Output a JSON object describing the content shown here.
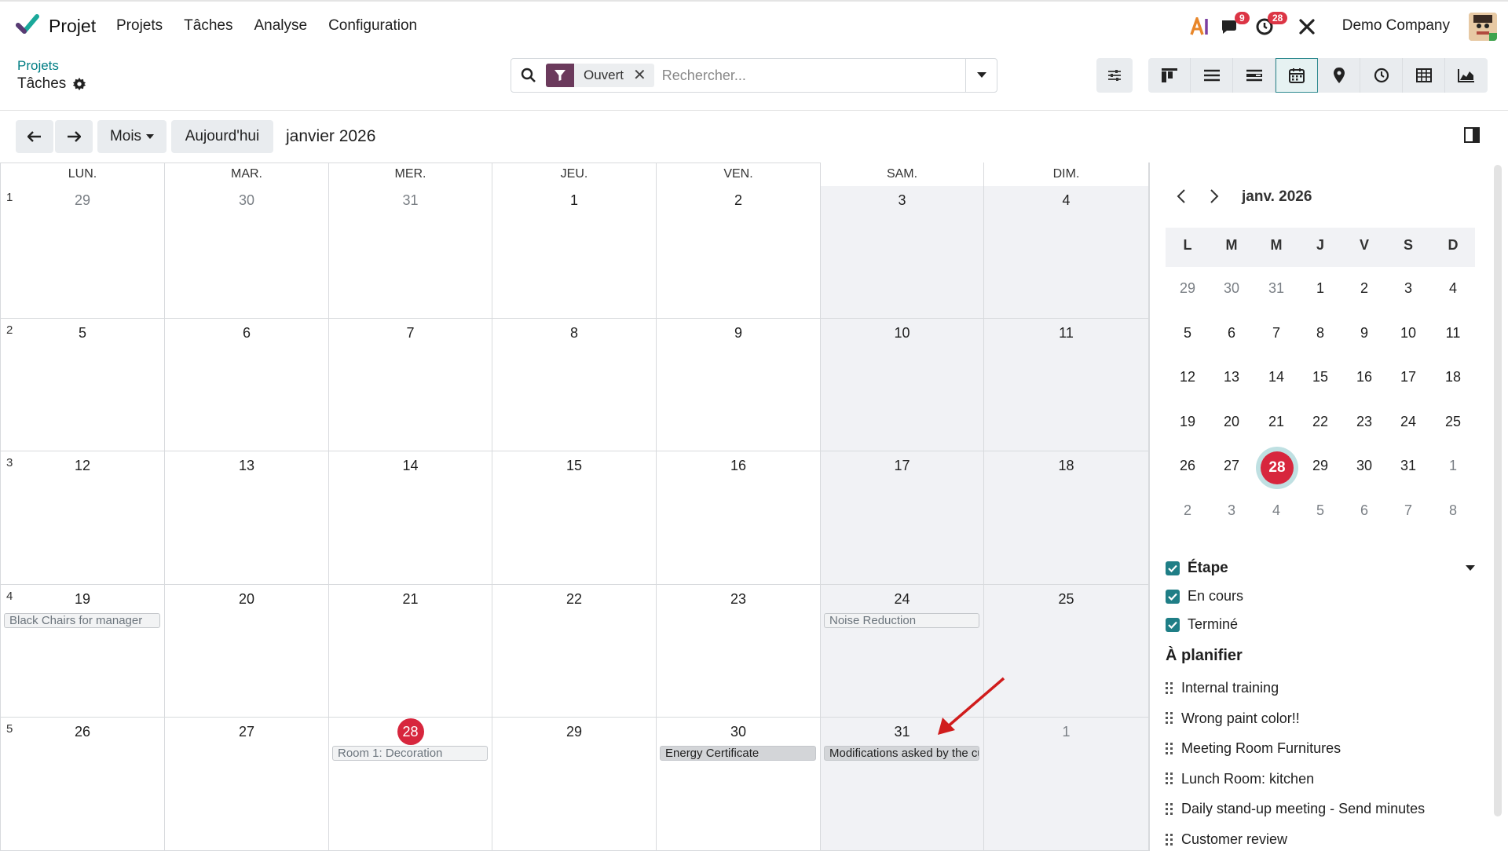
{
  "navbar": {
    "app_name": "Projet",
    "menu": [
      "Projets",
      "Tâches",
      "Analyse",
      "Configuration"
    ],
    "messages_badge": "9",
    "activities_badge": "28",
    "company": "Demo Company"
  },
  "breadcrumb": {
    "parent": "Projets",
    "current": "Tâches"
  },
  "search": {
    "facet": "Ouvert",
    "placeholder": "Rechercher..."
  },
  "toolbar": {
    "scale": "Mois",
    "today": "Aujourd'hui",
    "title": "janvier 2026"
  },
  "calendar": {
    "weekdays": [
      "LUN.",
      "MAR.",
      "MER.",
      "JEU.",
      "VEN.",
      "SAM.",
      "DIM."
    ],
    "weeks": [
      {
        "num": "1",
        "days": [
          "29",
          "30",
          "31",
          "1",
          "2",
          "3",
          "4"
        ]
      },
      {
        "num": "2",
        "days": [
          "5",
          "6",
          "7",
          "8",
          "9",
          "10",
          "11"
        ]
      },
      {
        "num": "3",
        "days": [
          "12",
          "13",
          "14",
          "15",
          "16",
          "17",
          "18"
        ]
      },
      {
        "num": "4",
        "days": [
          "19",
          "20",
          "21",
          "22",
          "23",
          "24",
          "25"
        ]
      },
      {
        "num": "5",
        "days": [
          "26",
          "27",
          "28",
          "29",
          "30",
          "31",
          "1"
        ]
      }
    ],
    "events": [
      {
        "label": "Black Chairs for manager",
        "week": 3,
        "day": 0,
        "style": "light"
      },
      {
        "label": "Noise Reduction",
        "week": 3,
        "day": 5,
        "style": "light"
      },
      {
        "label": "Room 1: Decoration",
        "week": 4,
        "day": 2,
        "style": "light"
      },
      {
        "label": "Energy Certificate",
        "week": 4,
        "day": 4,
        "style": "dark"
      },
      {
        "label": "Modifications asked by the customer",
        "week": 4,
        "day": 5,
        "style": "dark"
      }
    ]
  },
  "mini_calendar": {
    "title": "janv. 2026",
    "headers": [
      "L",
      "M",
      "M",
      "J",
      "V",
      "S",
      "D"
    ],
    "rows": [
      [
        "29",
        "30",
        "31",
        "1",
        "2",
        "3",
        "4"
      ],
      [
        "5",
        "6",
        "7",
        "8",
        "9",
        "10",
        "11"
      ],
      [
        "12",
        "13",
        "14",
        "15",
        "16",
        "17",
        "18"
      ],
      [
        "19",
        "20",
        "21",
        "22",
        "23",
        "24",
        "25"
      ],
      [
        "26",
        "27",
        "28",
        "29",
        "30",
        "31",
        "1"
      ],
      [
        "2",
        "3",
        "4",
        "5",
        "6",
        "7",
        "8"
      ]
    ],
    "today": "28"
  },
  "filters": {
    "group_label": "Étape",
    "items": [
      "En cours",
      "Terminé"
    ]
  },
  "to_plan": {
    "title": "À planifier",
    "items": [
      "Internal training",
      "Wrong paint color!!",
      "Meeting Room Furnitures",
      "Lunch Room: kitchen",
      "Daily stand-up meeting - Send minutes",
      "Customer review"
    ]
  },
  "colors": {
    "accent": "#017e84",
    "today": "#d7263d",
    "facet": "#6b3a5c",
    "check": "#1f7e86"
  },
  "icons": [
    "arrow-left-icon",
    "arrow-right-icon",
    "search-icon",
    "filter-icon",
    "sliders-icon",
    "calendar-icon",
    "map-pin-icon",
    "clock-icon",
    "table-icon",
    "area-chart-icon",
    "gear-icon"
  ]
}
